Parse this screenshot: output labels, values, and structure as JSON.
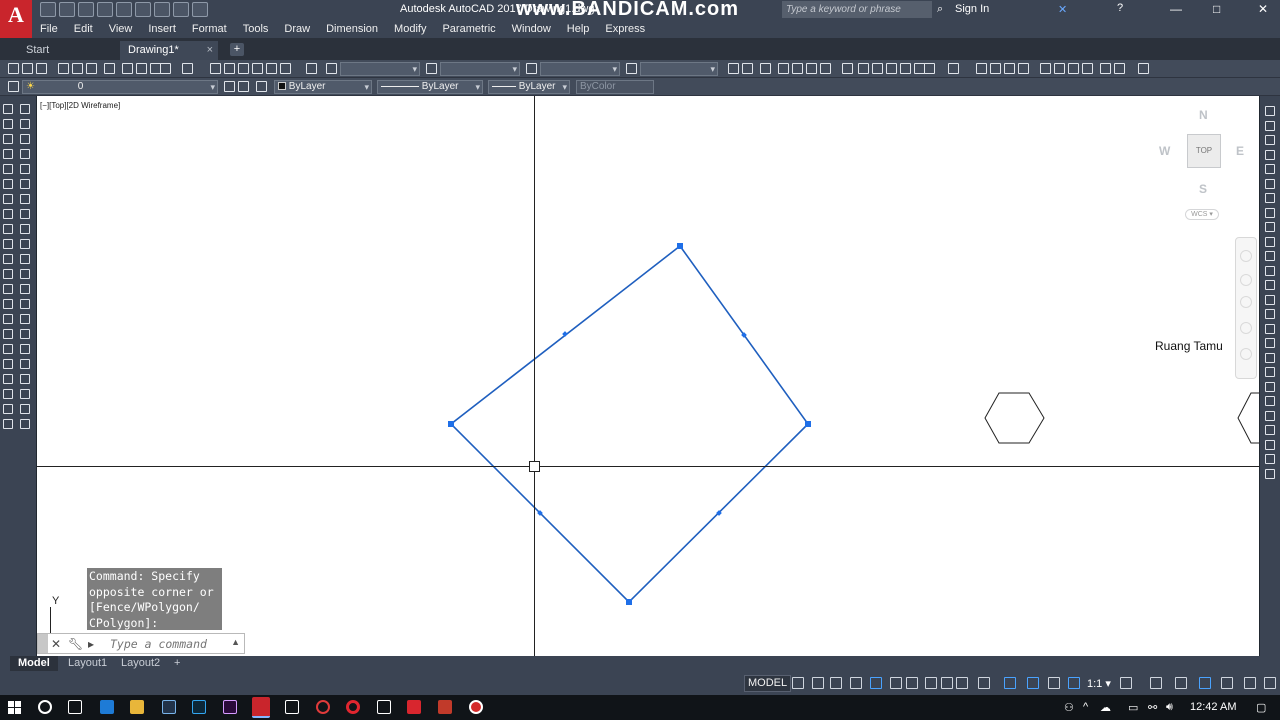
{
  "app": {
    "title": "Autodesk AutoCAD 2017   Drawing1.dwg",
    "logo_letter": "A",
    "watermark": "www.BANDICAM.com",
    "search_placeholder": "Type a keyword or phrase",
    "sign_in": "Sign In"
  },
  "menu": [
    "File",
    "Edit",
    "View",
    "Insert",
    "Format",
    "Tools",
    "Draw",
    "Dimension",
    "Modify",
    "Parametric",
    "Window",
    "Help",
    "Express"
  ],
  "tabs": {
    "start": "Start",
    "drawing": "Drawing1*",
    "close": "×",
    "add": "+"
  },
  "properties": {
    "layer": "0",
    "color": "ByLayer",
    "linetype": "ByLayer",
    "lineweight": "ByLayer",
    "plotstyle": "ByColor"
  },
  "canvas": {
    "viewport_label": "[−][Top][2D Wireframe]",
    "text_label": "Ruang Tamu"
  },
  "viewcube": {
    "n": "N",
    "s": "S",
    "e": "E",
    "w": "W",
    "top": "TOP",
    "wcs": "WCS ▾"
  },
  "command": {
    "history": [
      "Command: Specify",
      "opposite corner or",
      "[Fence/WPolygon/",
      "CPolygon]:"
    ],
    "placeholder": "Type a command"
  },
  "ucs": {
    "y": "Y"
  },
  "layout_tabs": [
    "Model",
    "Layout1",
    "Layout2"
  ],
  "layout_add": "+",
  "status": {
    "model": "MODEL",
    "scale": "1:1 ▾"
  },
  "taskbar": {
    "time": "12:42 AM"
  },
  "colors": {
    "selection": "#1f5fbf",
    "grip": "#1f6fe8",
    "autocad_red": "#c9252c"
  }
}
